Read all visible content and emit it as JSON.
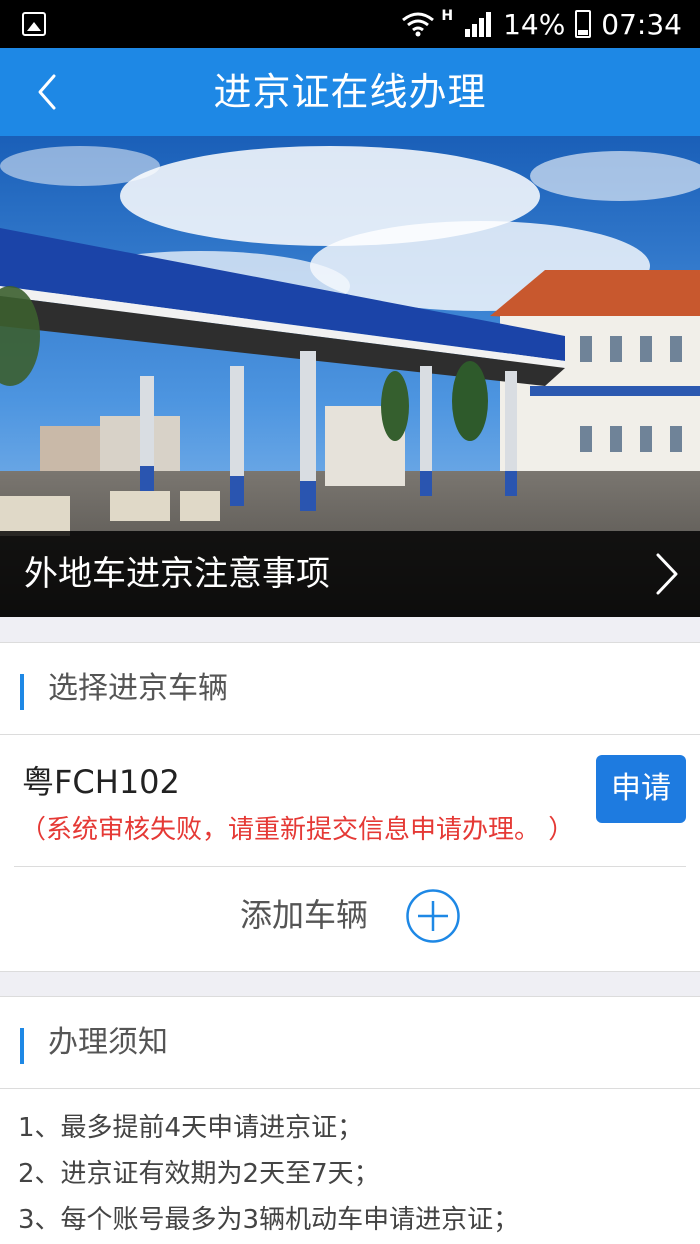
{
  "status_bar": {
    "network_type": "H",
    "battery": "14%",
    "time": "07:34"
  },
  "nav": {
    "title": "进京证在线办理"
  },
  "banner": {
    "caption": "外地车进京注意事项"
  },
  "vehicle_section": {
    "title": "选择进京车辆",
    "vehicles": [
      {
        "plate": "粤FCH102",
        "status": "（系统审核失败，请重新提交信息申请办理。 ）",
        "action_label": "申请"
      }
    ],
    "add_label": "添加车辆"
  },
  "notice_section": {
    "title": "办理须知",
    "items": [
      "1、最多提前4天申请进京证；",
      "2、进京证有效期为2天至7天；",
      "3、每个账号最多为3辆机动车申请进京证；"
    ]
  },
  "colors": {
    "accent": "#1e88e5",
    "error": "#e53935",
    "status_bar": "#000000"
  }
}
